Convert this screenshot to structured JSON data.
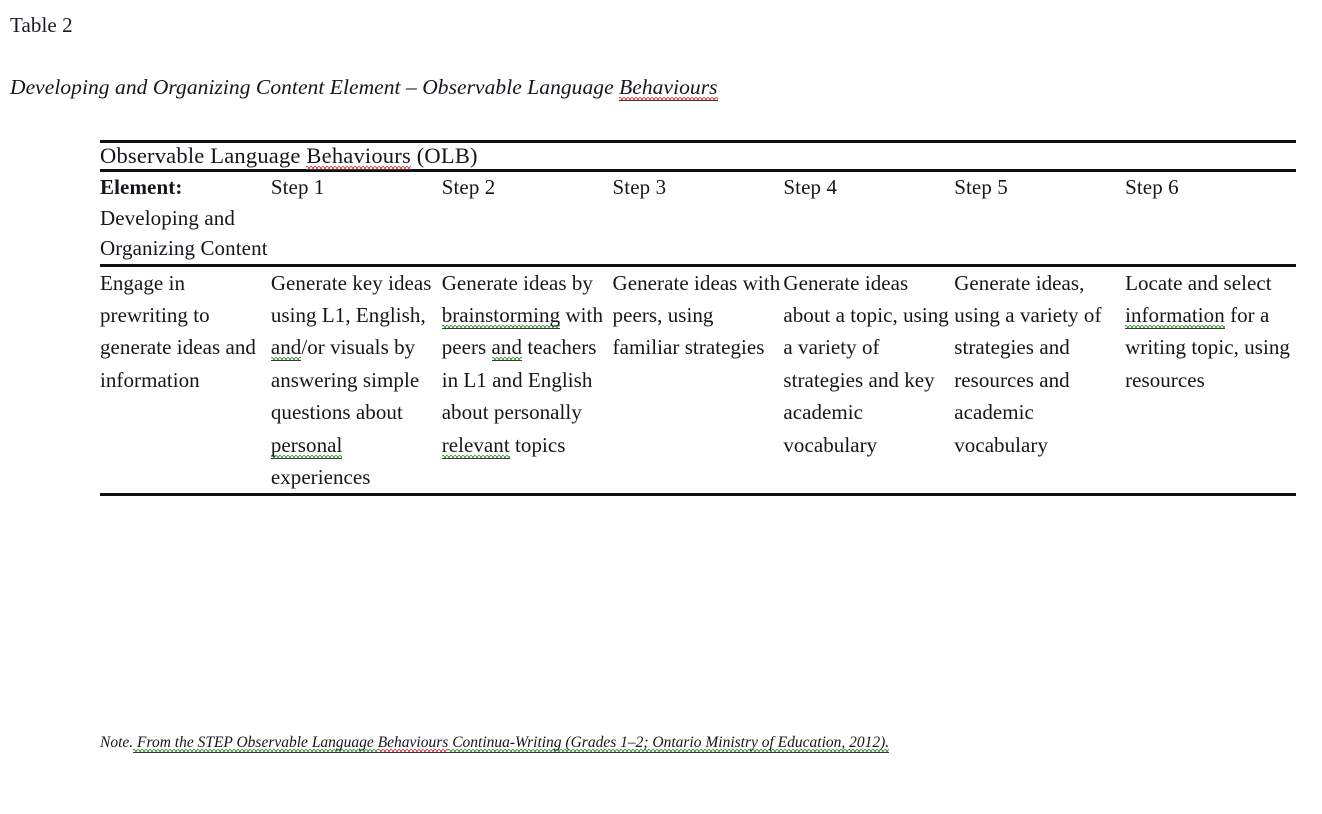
{
  "caption": {
    "number": "Table 2",
    "title": "Developing and Organizing Content Element – Observable Language Behaviours",
    "title_misspelled_word": "Behaviours"
  },
  "table": {
    "banner": {
      "text": "Observable Language Behaviours (OLB)",
      "misspelled_word": "Behaviours",
      "prefix": "Observable Language ",
      "suffix": " (OLB)"
    },
    "column_headers": [
      {
        "bold_prefix": "Element:",
        "label": "Developing and Organizing Content"
      },
      {
        "label": "Step 1"
      },
      {
        "label": "Step 2"
      },
      {
        "label": "Step 3"
      },
      {
        "label": "Step 4"
      },
      {
        "label": "Step 5"
      },
      {
        "label": "Step 6"
      }
    ],
    "rows": [
      {
        "element": "Engage in prewriting to generate ideas and information",
        "cells": [
          {
            "segments": [
              {
                "text": "Generate key ideas using L1, English, ",
                "mark": "none"
              },
              {
                "text": "and",
                "mark": "green"
              },
              {
                "text": "/or visuals by answering simple questions about ",
                "mark": "none"
              },
              {
                "text": "personal",
                "mark": "green"
              },
              {
                "text": " experiences",
                "mark": "none"
              }
            ]
          },
          {
            "segments": [
              {
                "text": "Generate ideas by ",
                "mark": "none"
              },
              {
                "text": "brainstorming",
                "mark": "green"
              },
              {
                "text": " with peers ",
                "mark": "none"
              },
              {
                "text": "and",
                "mark": "green"
              },
              {
                "text": " teachers in L1 and English about personally ",
                "mark": "none"
              },
              {
                "text": "relevant",
                "mark": "green"
              },
              {
                "text": " topics",
                "mark": "none"
              }
            ]
          },
          {
            "segments": [
              {
                "text": "Generate ideas with peers, using familiar strategies",
                "mark": "none"
              }
            ]
          },
          {
            "segments": [
              {
                "text": "Generate ideas about a topic, using a variety of strategies and key academic vocabulary",
                "mark": "none"
              }
            ]
          },
          {
            "segments": [
              {
                "text": "Generate ideas, using a variety of strategies and resources and academic vocabulary",
                "mark": "none"
              }
            ]
          },
          {
            "segments": [
              {
                "text": "Locate and select ",
                "mark": "none"
              },
              {
                "text": "information",
                "mark": "green"
              },
              {
                "text": " for a writing topic, using resources",
                "mark": "none"
              }
            ]
          }
        ]
      }
    ]
  },
  "note": {
    "label": "Note.",
    "segments": [
      {
        "text": " From the STEP Observable Language ",
        "mark": "green"
      },
      {
        "text": "Behaviours",
        "mark": "red"
      },
      {
        "text": " Continua-Writing (Grades 1–2; Ontario Ministry of Education, 2012).",
        "mark": "green"
      }
    ]
  },
  "colors": {
    "rule": "#111111",
    "text": "#15151c",
    "spellcheck_red": "#e01b1b",
    "grammarcheck_green": "#1f8a1f"
  }
}
